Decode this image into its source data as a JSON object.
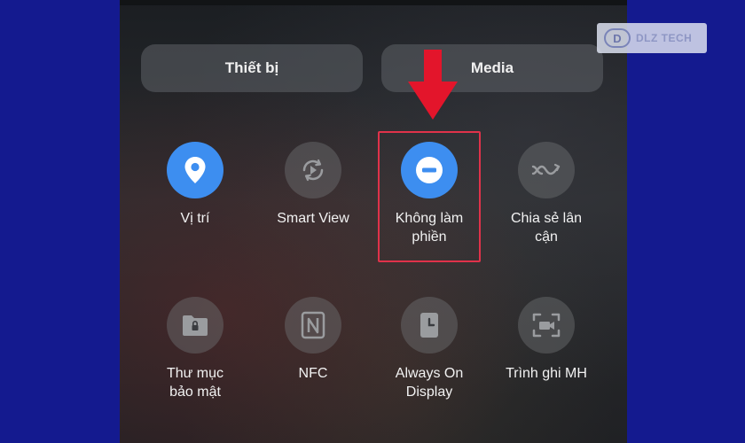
{
  "tabs": {
    "devices": "Thiết bị",
    "media": "Media"
  },
  "tiles": [
    {
      "label": "Vị trí",
      "icon": "location-pin-icon",
      "active": true
    },
    {
      "label": "Smart View",
      "icon": "smart-view-icon",
      "active": false
    },
    {
      "label": "Không làm phiền",
      "icon": "do-not-disturb-icon",
      "active": true
    },
    {
      "label": "Chia sẻ lân cận",
      "icon": "nearby-share-icon",
      "active": false
    },
    {
      "label": "Thư mục bảo mật",
      "icon": "secure-folder-icon",
      "active": false
    },
    {
      "label": "NFC",
      "icon": "nfc-icon",
      "active": false
    },
    {
      "label": "Always On Display",
      "icon": "always-on-display-icon",
      "active": false
    },
    {
      "label": "Trình ghi MH",
      "icon": "screen-recorder-icon",
      "active": false
    }
  ],
  "colors": {
    "accent": "#3d8ef0",
    "highlight": "#e0324a",
    "frame": "#141a8f"
  },
  "watermark": {
    "text": "DLZ TECH",
    "mark": "D"
  }
}
